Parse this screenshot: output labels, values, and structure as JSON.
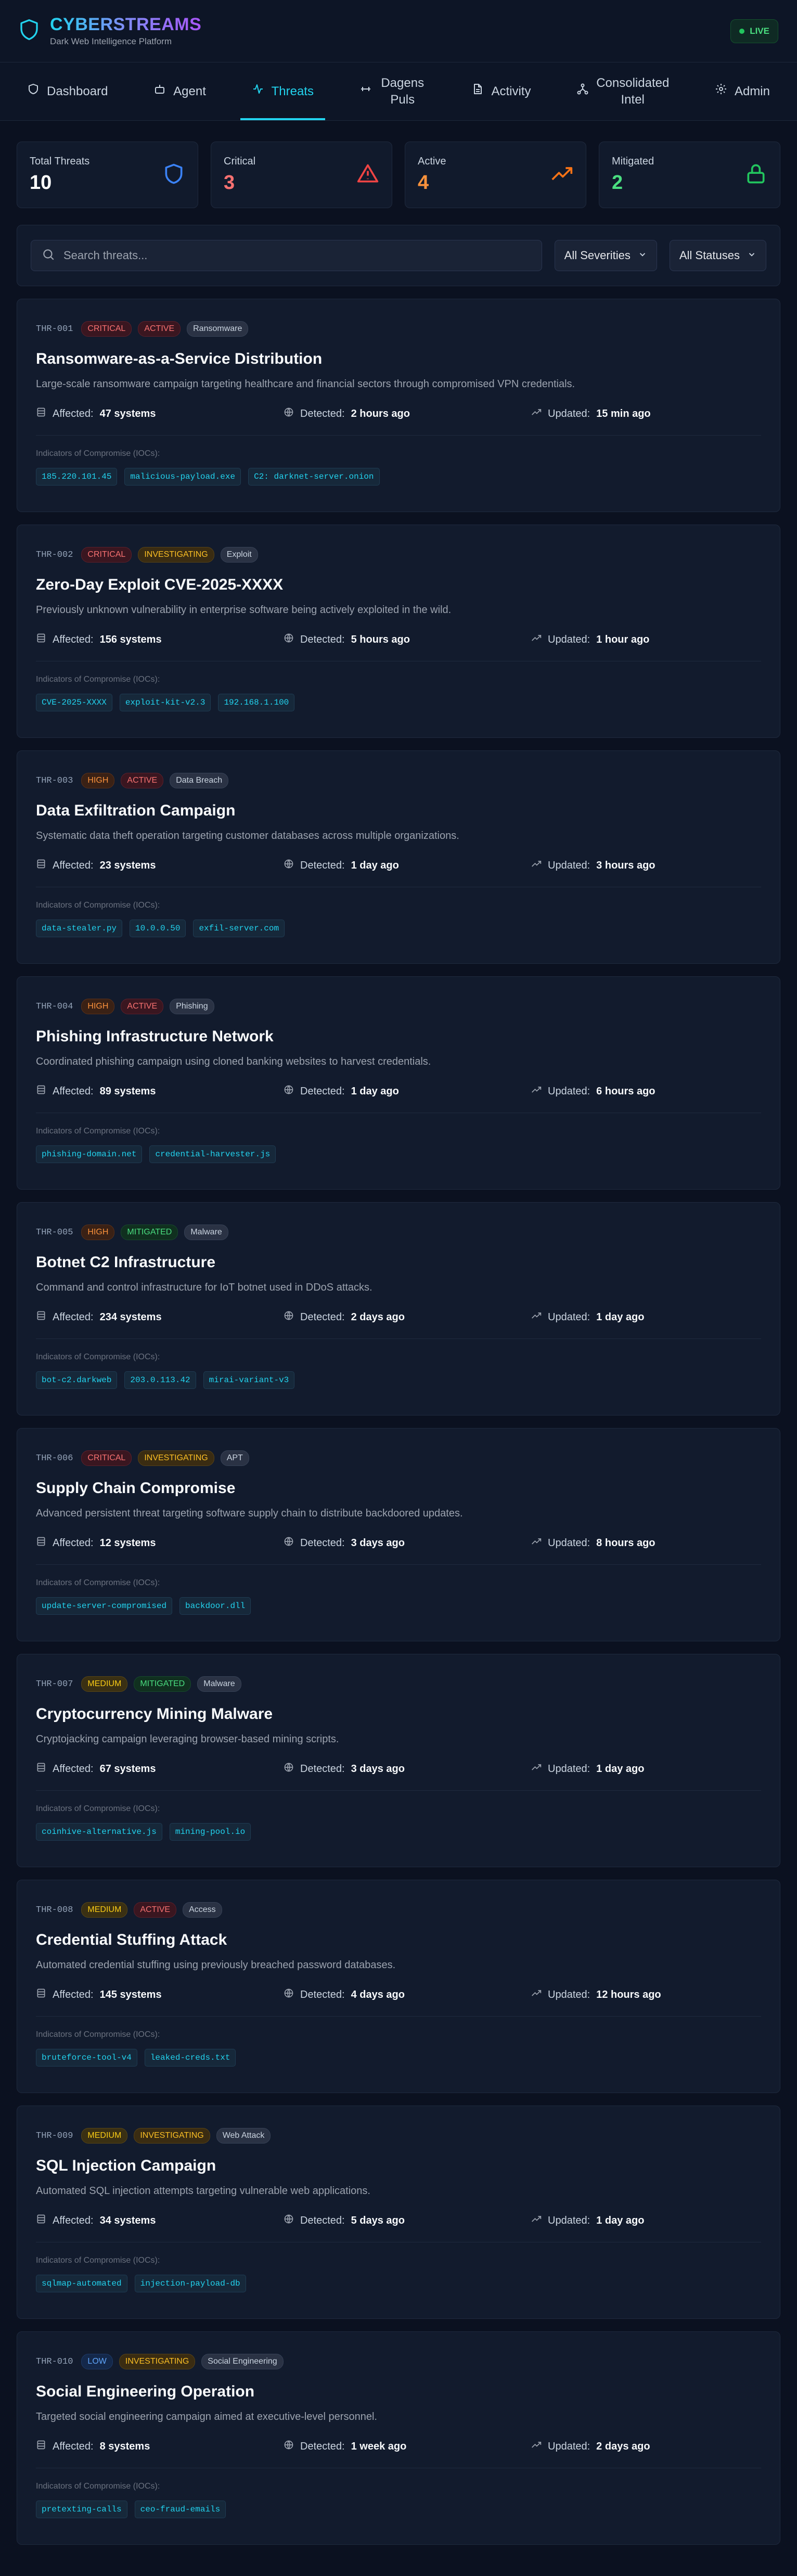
{
  "header": {
    "brand_title": "CYBERSTREAMS",
    "brand_subtitle": "Dark Web Intelligence Platform",
    "live_label": "LIVE"
  },
  "nav": {
    "items": [
      {
        "label": "Dashboard",
        "icon": "shield-icon"
      },
      {
        "label": "Agent",
        "icon": "bot-icon"
      },
      {
        "label": "Threats",
        "icon": "activity-icon",
        "active": true
      },
      {
        "label": "Dagens Puls",
        "icon": "pulse-icon"
      },
      {
        "label": "Activity",
        "icon": "document-icon"
      },
      {
        "label": "Consolidated Intel",
        "icon": "network-icon"
      },
      {
        "label": "Admin",
        "icon": "gear-icon"
      }
    ]
  },
  "stats": [
    {
      "label": "Total Threats",
      "value": "10",
      "color": "#ffffff",
      "icon": "shield-icon",
      "icon_color": "#3b82f6"
    },
    {
      "label": "Critical",
      "value": "3",
      "color": "#f87171",
      "icon": "warning-triangle-icon",
      "icon_color": "#ef4444"
    },
    {
      "label": "Active",
      "value": "4",
      "color": "#fb923c",
      "icon": "trending-up-icon",
      "icon_color": "#f97316"
    },
    {
      "label": "Mitigated",
      "value": "2",
      "color": "#4ade80",
      "icon": "lock-icon",
      "icon_color": "#22c55e"
    }
  ],
  "filters": {
    "search_placeholder": "Search threats...",
    "severity_value": "All Severities",
    "status_value": "All Statuses"
  },
  "card_labels": {
    "affected": "Affected:",
    "detected": "Detected:",
    "updated": "Updated:",
    "ioc_heading": "Indicators of Compromise (IOCs):"
  },
  "colors": {
    "accent": "#22d3ee",
    "background": "#0b1120",
    "card": "#121b2d"
  },
  "threats": [
    {
      "id": "THR-001",
      "severity": "CRITICAL",
      "status": "ACTIVE",
      "category": "Ransomware",
      "title": "Ransomware-as-a-Service Distribution",
      "description": "Large-scale ransomware campaign targeting healthcare and financial sectors through compromised VPN credentials.",
      "affected": "47 systems",
      "detected": "2 hours ago",
      "updated": "15 min ago",
      "iocs": [
        "185.220.101.45",
        "malicious-payload.exe",
        "C2: darknet-server.onion"
      ]
    },
    {
      "id": "THR-002",
      "severity": "CRITICAL",
      "status": "INVESTIGATING",
      "category": "Exploit",
      "title": "Zero-Day Exploit CVE-2025-XXXX",
      "description": "Previously unknown vulnerability in enterprise software being actively exploited in the wild.",
      "affected": "156 systems",
      "detected": "5 hours ago",
      "updated": "1 hour ago",
      "iocs": [
        "CVE-2025-XXXX",
        "exploit-kit-v2.3",
        "192.168.1.100"
      ]
    },
    {
      "id": "THR-003",
      "severity": "HIGH",
      "status": "ACTIVE",
      "category": "Data Breach",
      "title": "Data Exfiltration Campaign",
      "description": "Systematic data theft operation targeting customer databases across multiple organizations.",
      "affected": "23 systems",
      "detected": "1 day ago",
      "updated": "3 hours ago",
      "iocs": [
        "data-stealer.py",
        "10.0.0.50",
        "exfil-server.com"
      ]
    },
    {
      "id": "THR-004",
      "severity": "HIGH",
      "status": "ACTIVE",
      "category": "Phishing",
      "title": "Phishing Infrastructure Network",
      "description": "Coordinated phishing campaign using cloned banking websites to harvest credentials.",
      "affected": "89 systems",
      "detected": "1 day ago",
      "updated": "6 hours ago",
      "iocs": [
        "phishing-domain.net",
        "credential-harvester.js"
      ]
    },
    {
      "id": "THR-005",
      "severity": "HIGH",
      "status": "MITIGATED",
      "category": "Malware",
      "title": "Botnet C2 Infrastructure",
      "description": "Command and control infrastructure for IoT botnet used in DDoS attacks.",
      "affected": "234 systems",
      "detected": "2 days ago",
      "updated": "1 day ago",
      "iocs": [
        "bot-c2.darkweb",
        "203.0.113.42",
        "mirai-variant-v3"
      ]
    },
    {
      "id": "THR-006",
      "severity": "CRITICAL",
      "status": "INVESTIGATING",
      "category": "APT",
      "title": "Supply Chain Compromise",
      "description": "Advanced persistent threat targeting software supply chain to distribute backdoored updates.",
      "affected": "12 systems",
      "detected": "3 days ago",
      "updated": "8 hours ago",
      "iocs": [
        "update-server-compromised",
        "backdoor.dll"
      ]
    },
    {
      "id": "THR-007",
      "severity": "MEDIUM",
      "status": "MITIGATED",
      "category": "Malware",
      "title": "Cryptocurrency Mining Malware",
      "description": "Cryptojacking campaign leveraging browser-based mining scripts.",
      "affected": "67 systems",
      "detected": "3 days ago",
      "updated": "1 day ago",
      "iocs": [
        "coinhive-alternative.js",
        "mining-pool.io"
      ]
    },
    {
      "id": "THR-008",
      "severity": "MEDIUM",
      "status": "ACTIVE",
      "category": "Access",
      "title": "Credential Stuffing Attack",
      "description": "Automated credential stuffing using previously breached password databases.",
      "affected": "145 systems",
      "detected": "4 days ago",
      "updated": "12 hours ago",
      "iocs": [
        "bruteforce-tool-v4",
        "leaked-creds.txt"
      ]
    },
    {
      "id": "THR-009",
      "severity": "MEDIUM",
      "status": "INVESTIGATING",
      "category": "Web Attack",
      "title": "SQL Injection Campaign",
      "description": "Automated SQL injection attempts targeting vulnerable web applications.",
      "affected": "34 systems",
      "detected": "5 days ago",
      "updated": "1 day ago",
      "iocs": [
        "sqlmap-automated",
        "injection-payload-db"
      ]
    },
    {
      "id": "THR-010",
      "severity": "LOW",
      "status": "INVESTIGATING",
      "category": "Social Engineering",
      "title": "Social Engineering Operation",
      "description": "Targeted social engineering campaign aimed at executive-level personnel.",
      "affected": "8 systems",
      "detected": "1 week ago",
      "updated": "2 days ago",
      "iocs": [
        "pretexting-calls",
        "ceo-fraud-emails"
      ]
    }
  ]
}
